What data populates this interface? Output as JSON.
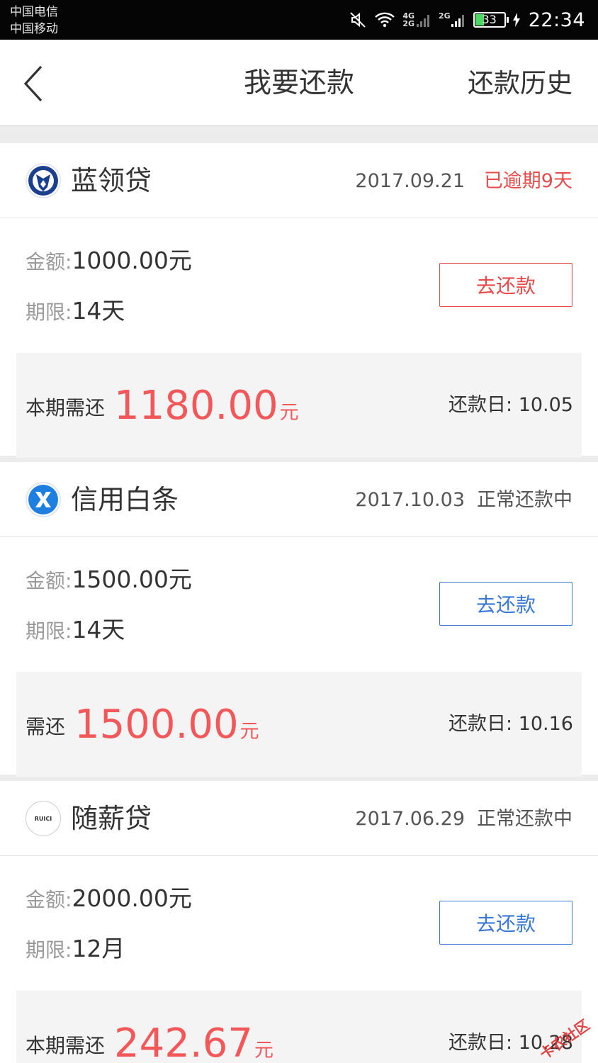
{
  "status_bar": {
    "carrier_1": "中国电信",
    "carrier_2": "中国移动",
    "net_1": "4G",
    "net_1b": "2G",
    "net_2": "2G",
    "battery": "33",
    "time": "22:34"
  },
  "nav": {
    "title": "我要还款",
    "history": "还款历史"
  },
  "loans": [
    {
      "name": "蓝领贷",
      "date": "2017.09.21",
      "status": "已逾期9天",
      "amount_label": "金额:",
      "amount": "1000.00元",
      "term_label": "期限:",
      "term": "14天",
      "button": "去还款",
      "due_label": "本期需还",
      "due_amount": "1180.00",
      "due_unit": "元",
      "due_date": "还款日: 10.05"
    },
    {
      "name": "信用白条",
      "date": "2017.10.03",
      "status": "正常还款中",
      "amount_label": "金额:",
      "amount": "1500.00元",
      "term_label": "期限:",
      "term": "14天",
      "button": "去还款",
      "due_label": "需还",
      "due_amount": "1500.00",
      "due_unit": "元",
      "due_date": "还款日: 10.16"
    },
    {
      "name": "随薪贷",
      "date": "2017.06.29",
      "status": "正常还款中",
      "amount_label": "金额:",
      "amount": "2000.00元",
      "term_label": "期限:",
      "term": "12月",
      "button": "去还款",
      "due_label": "本期需还",
      "due_amount": "242.67",
      "due_unit": "元",
      "due_date": "还款日: 10.28"
    }
  ],
  "logo_text_3": "RUICI",
  "watermark": "卡农社区",
  "colors": {
    "accent_red": "#f2585a",
    "overdue_red": "#e84a4a",
    "button_blue": "#3a78d6",
    "battery_green": "#4bd964"
  }
}
